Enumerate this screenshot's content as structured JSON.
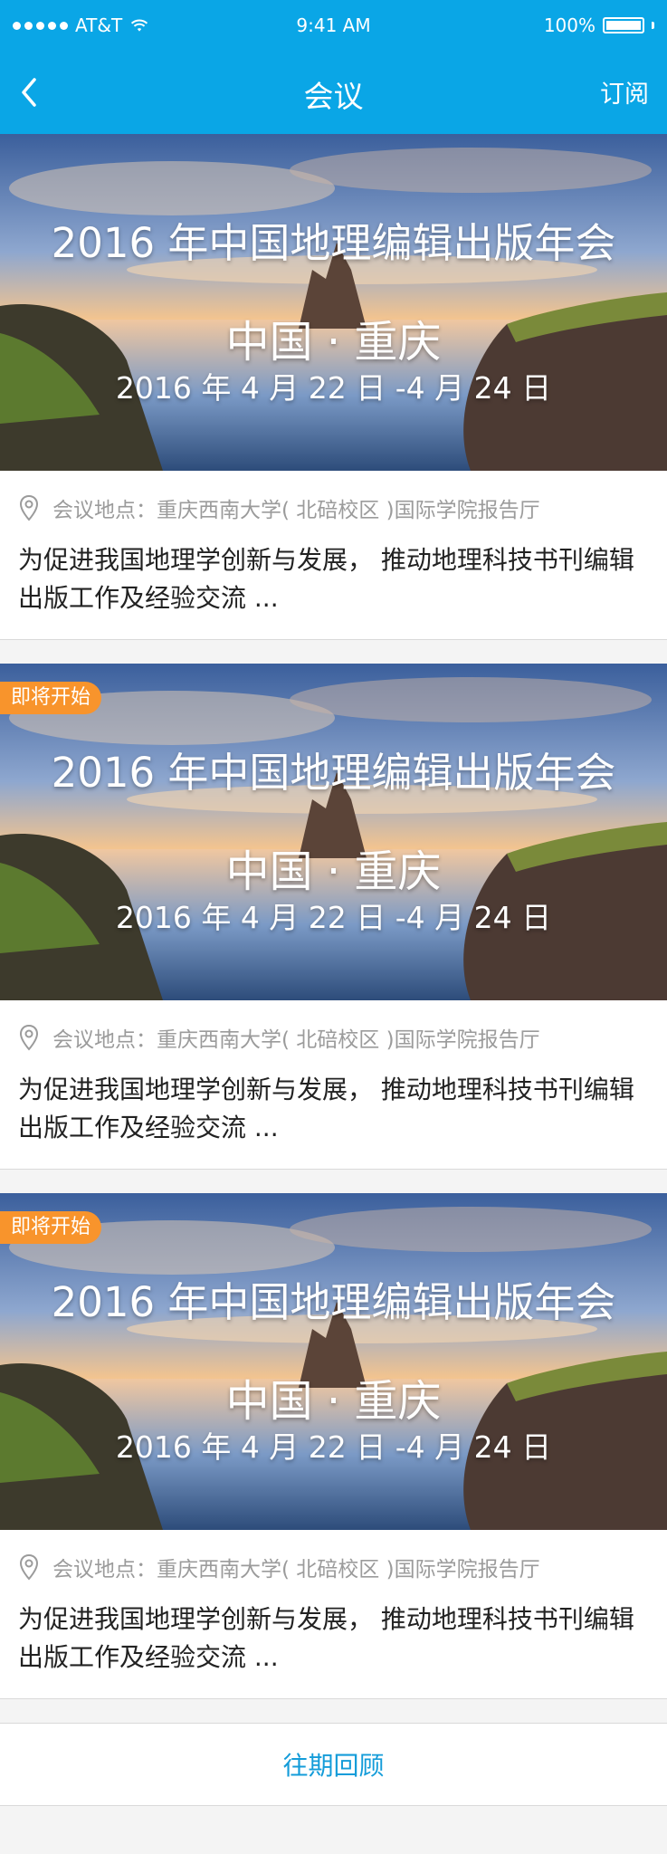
{
  "status": {
    "carrier": "AT&T",
    "time": "9:41 AM",
    "battery": "100%"
  },
  "nav": {
    "title": "会议",
    "subscribe": "订阅",
    "back_icon": "chevron-left-icon"
  },
  "cards": [
    {
      "badge": "",
      "title": "2016 年中国地理编辑出版年会",
      "city": "中国 · 重庆",
      "dates": "2016 年 4 月 22 日 -4 月 24 日",
      "location": "会议地点：重庆西南大学( 北碚校区 )国际学院报告厅",
      "description": "为促进我国地理学创新与发展， 推动地理科技书刊编辑出版工作及经验交流 ..."
    },
    {
      "badge": "即将开始",
      "title": "2016 年中国地理编辑出版年会",
      "city": "中国 · 重庆",
      "dates": "2016 年 4 月 22 日 -4 月 24 日",
      "location": "会议地点：重庆西南大学( 北碚校区 )国际学院报告厅",
      "description": "为促进我国地理学创新与发展， 推动地理科技书刊编辑出版工作及经验交流 ..."
    },
    {
      "badge": "即将开始",
      "title": "2016 年中国地理编辑出版年会",
      "city": "中国 · 重庆",
      "dates": "2016 年 4 月 22 日 -4 月 24 日",
      "location": "会议地点：重庆西南大学( 北碚校区 )国际学院报告厅",
      "description": "为促进我国地理学创新与发展， 推动地理科技书刊编辑出版工作及经验交流 ..."
    }
  ],
  "history_label": "往期回顾",
  "colors": {
    "header": "#0aa6e6",
    "badge": "#f8942c",
    "link": "#149cd9"
  }
}
